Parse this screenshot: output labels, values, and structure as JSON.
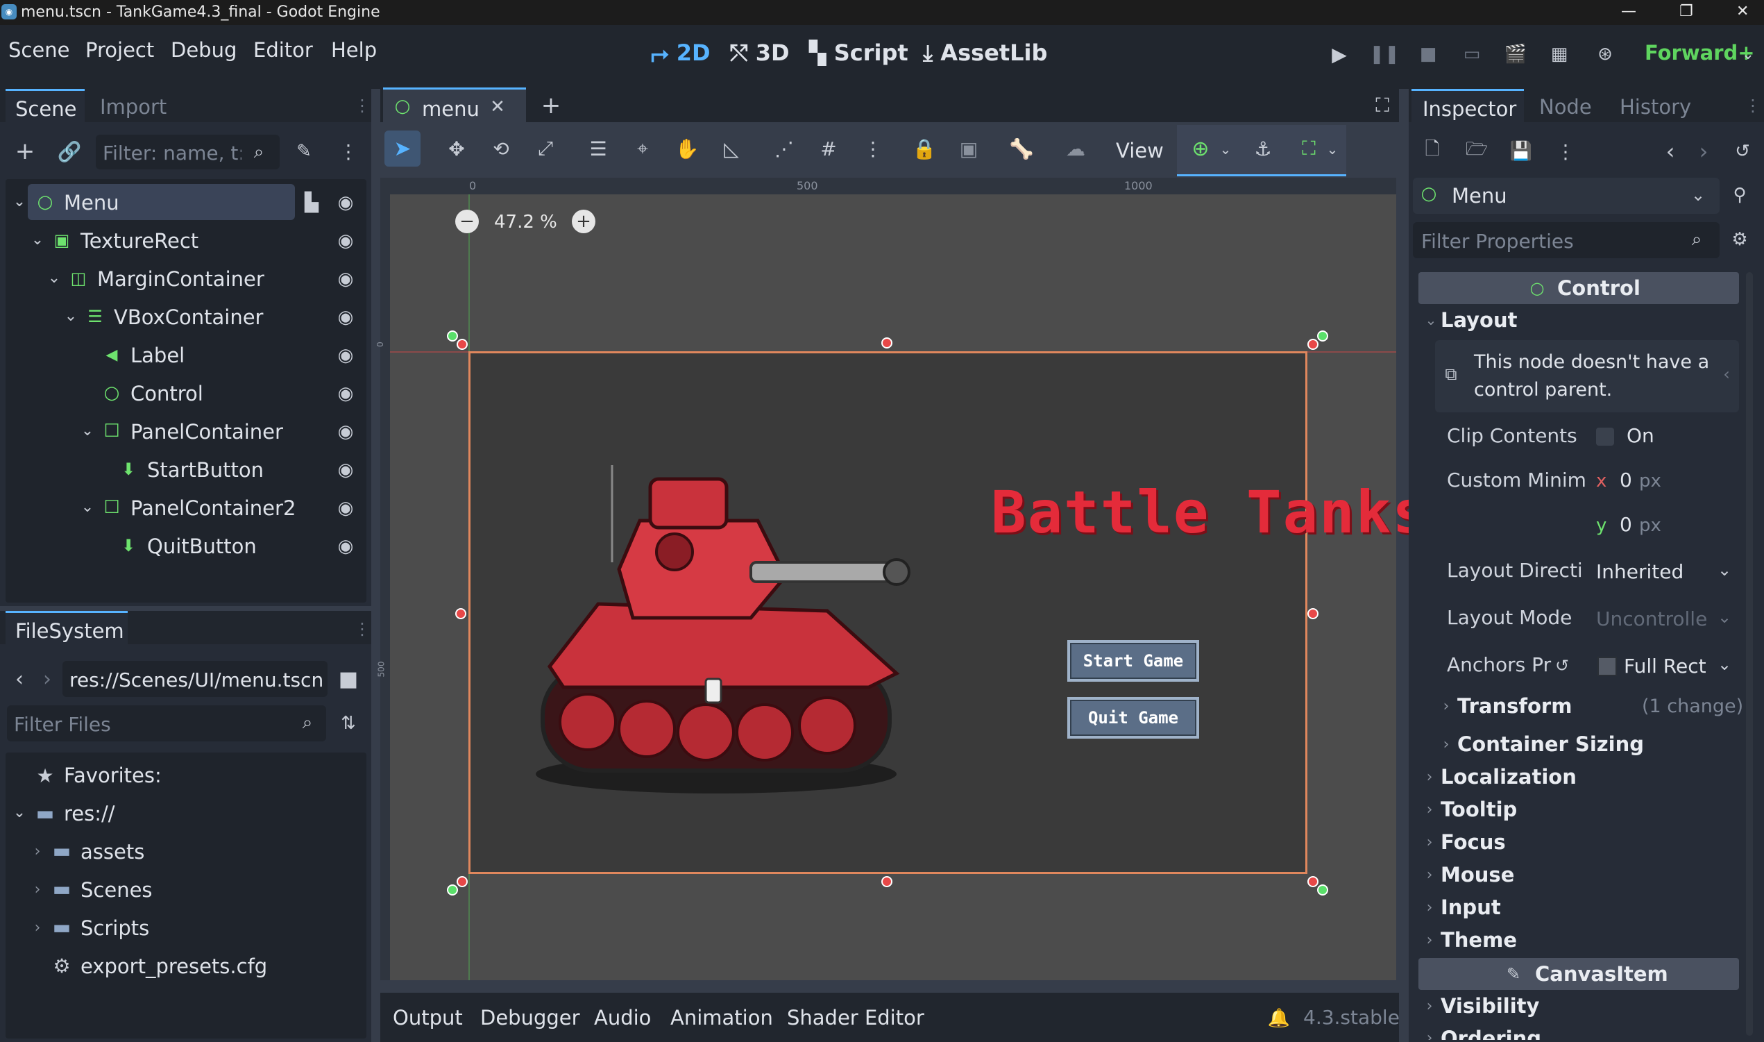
{
  "window": {
    "title": "menu.tscn - TankGame4.3_final - Godot Engine",
    "min": "—",
    "max": "❐",
    "close": "✕"
  },
  "menu": {
    "items": [
      "Scene",
      "Project",
      "Debug",
      "Editor",
      "Help"
    ]
  },
  "workspaces": {
    "2d": "2D",
    "3d": "3D",
    "script": "Script",
    "assetlib": "AssetLib"
  },
  "renderer": "Forward+",
  "scene_dock": {
    "tabs": [
      "Scene",
      "Import"
    ],
    "filter_placeholder": "Filter: name, t:t",
    "nodes": [
      {
        "label": "Menu",
        "icon": "control-icon"
      },
      {
        "label": "TextureRect",
        "icon": "texture-rect-icon"
      },
      {
        "label": "MarginContainer",
        "icon": "margin-container-icon"
      },
      {
        "label": "VBoxContainer",
        "icon": "vbox-container-icon"
      },
      {
        "label": "Label",
        "icon": "label-icon"
      },
      {
        "label": "Control",
        "icon": "control-icon"
      },
      {
        "label": "PanelContainer",
        "icon": "panel-container-icon"
      },
      {
        "label": "StartButton",
        "icon": "button-icon"
      },
      {
        "label": "PanelContainer2",
        "icon": "panel-container-icon"
      },
      {
        "label": "QuitButton",
        "icon": "button-icon"
      }
    ]
  },
  "filesystem": {
    "tab": "FileSystem",
    "path": "res://Scenes/UI/menu.tscn",
    "filter_placeholder": "Filter Files",
    "items": [
      {
        "label": "Favorites:"
      },
      {
        "label": "res://"
      },
      {
        "label": "assets"
      },
      {
        "label": "Scenes"
      },
      {
        "label": "Scripts"
      },
      {
        "label": "export_presets.cfg"
      }
    ]
  },
  "editor": {
    "tab": "menu",
    "zoom": "47.2 %",
    "view_menu": "View",
    "ruler": [
      "0",
      "500",
      "1000"
    ],
    "ruler_v": [
      "0",
      "500"
    ]
  },
  "game": {
    "title": "Battle Tanks",
    "start": "Start Game",
    "quit": "Quit Game"
  },
  "bottom": {
    "tabs": [
      "Output",
      "Debugger",
      "Audio",
      "Animation",
      "Shader Editor"
    ],
    "version": "4.3.stable"
  },
  "inspector": {
    "tabs": [
      "Inspector",
      "Node",
      "History"
    ],
    "node": "Menu",
    "filter_placeholder": "Filter Properties",
    "class_header": "Control",
    "layout": "Layout",
    "warning": "This node doesn't have a control parent.",
    "clip_label": "Clip Contents",
    "clip_value": "On",
    "min_label": "Custom Minim",
    "x": "x",
    "y": "y",
    "x_val": "0",
    "y_val": "0",
    "unit": "px",
    "dir_label": "Layout Directi",
    "dir_value": "Inherited",
    "mode_label": "Layout Mode",
    "mode_value": "Uncontrolle",
    "anchors_label": "Anchors Pr",
    "anchors_value": "Full Rect",
    "transform": "Transform",
    "transform_note": "(1 change)",
    "container_sizing": "Container Sizing",
    "sections": [
      "Localization",
      "Tooltip",
      "Focus",
      "Mouse",
      "Input",
      "Theme"
    ],
    "canvas_item": "CanvasItem",
    "visibility": "Visibility",
    "ordering": "Ordering"
  },
  "colors": {
    "accent": "#57b3ff",
    "selection": "#e0875d",
    "handle_red": "#e84848",
    "handle_green": "#5adf6a",
    "title_red": "#e42b3a"
  }
}
